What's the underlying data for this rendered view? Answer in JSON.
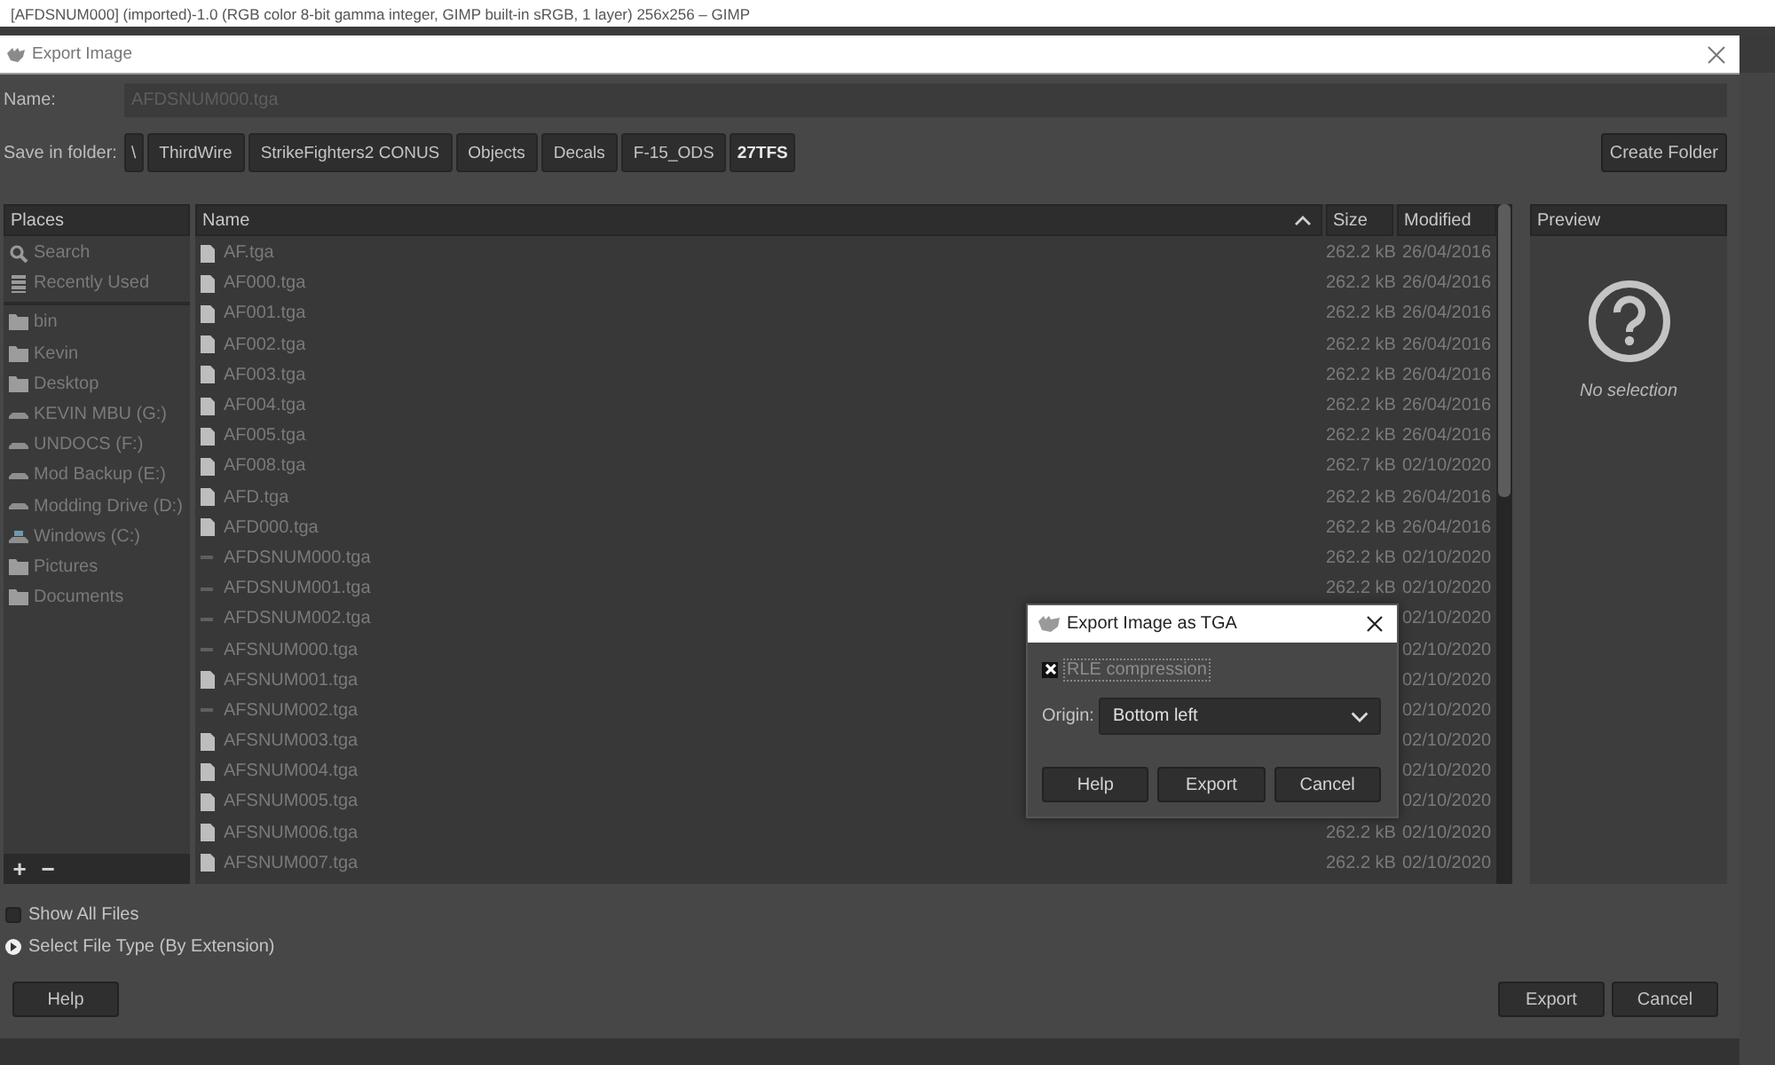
{
  "app_window": {
    "title": "[AFDSNUM000] (imported)-1.0 (RGB color 8-bit gamma integer, GIMP built-in sRGB, 1 layer) 256x256 – GIMP"
  },
  "export_dialog": {
    "title": "Export Image",
    "name_label": "Name:",
    "name_value": "AFDSNUM000.tga",
    "folder_label": "Save in folder:",
    "path": [
      {
        "label": "\\",
        "selected": false
      },
      {
        "label": "ThirdWire",
        "selected": false
      },
      {
        "label": "StrikeFighters2 CONUS",
        "selected": false
      },
      {
        "label": "Objects",
        "selected": false
      },
      {
        "label": "Decals",
        "selected": false
      },
      {
        "label": "F-15_ODS",
        "selected": false
      },
      {
        "label": "27TFS",
        "selected": true
      }
    ],
    "create_folder": "Create Folder",
    "places": {
      "header": "Places",
      "shortcuts": [
        {
          "label": "Search",
          "kind": "search"
        },
        {
          "label": "Recently Used",
          "kind": "recent"
        }
      ],
      "locations": [
        {
          "label": "bin",
          "kind": "folder"
        },
        {
          "label": "Kevin",
          "kind": "folder"
        },
        {
          "label": "Desktop",
          "kind": "folder"
        },
        {
          "label": "KEVIN MBU (G:)",
          "kind": "drive"
        },
        {
          "label": "UNDOCS (F:)",
          "kind": "drive"
        },
        {
          "label": "Mod Backup (E:)",
          "kind": "drive"
        },
        {
          "label": "Modding Drive (D:)",
          "kind": "drive"
        },
        {
          "label": "Windows (C:)",
          "kind": "system-drive"
        },
        {
          "label": "Pictures",
          "kind": "folder"
        },
        {
          "label": "Documents",
          "kind": "folder"
        }
      ],
      "buttons": [
        "+",
        "−"
      ]
    },
    "columns": [
      {
        "label": "Name",
        "sorted": true
      },
      {
        "label": "Size",
        "sorted": false
      },
      {
        "label": "Modified",
        "sorted": false
      }
    ],
    "files": [
      {
        "name": "AF.tga",
        "kind": "document",
        "size": "262.2 kB",
        "modified": "26/04/2016"
      },
      {
        "name": "AF000.tga",
        "kind": "document",
        "size": "262.2 kB",
        "modified": "26/04/2016"
      },
      {
        "name": "AF001.tga",
        "kind": "document",
        "size": "262.2 kB",
        "modified": "26/04/2016"
      },
      {
        "name": "AF002.tga",
        "kind": "document",
        "size": "262.2 kB",
        "modified": "26/04/2016"
      },
      {
        "name": "AF003.tga",
        "kind": "document",
        "size": "262.2 kB",
        "modified": "26/04/2016"
      },
      {
        "name": "AF004.tga",
        "kind": "document",
        "size": "262.2 kB",
        "modified": "26/04/2016"
      },
      {
        "name": "AF005.tga",
        "kind": "document",
        "size": "262.2 kB",
        "modified": "26/04/2016"
      },
      {
        "name": "AF008.tga",
        "kind": "document",
        "size": "262.7 kB",
        "modified": "02/10/2020"
      },
      {
        "name": "AFD.tga",
        "kind": "document",
        "size": "262.2 kB",
        "modified": "26/04/2016"
      },
      {
        "name": "AFD000.tga",
        "kind": "document",
        "size": "262.2 kB",
        "modified": "26/04/2016"
      },
      {
        "name": "AFDSNUM000.tga",
        "kind": "thumbnail",
        "size": "262.2 kB",
        "modified": "02/10/2020"
      },
      {
        "name": "AFDSNUM001.tga",
        "kind": "thumbnail",
        "size": "262.2 kB",
        "modified": "02/10/2020"
      },
      {
        "name": "AFDSNUM002.tga",
        "kind": "thumbnail",
        "modified": "02/10/2020"
      },
      {
        "name": "AFSNUM000.tga",
        "kind": "thumbnail",
        "modified": "02/10/2020"
      },
      {
        "name": "AFSNUM001.tga",
        "kind": "document",
        "modified": "02/10/2020"
      },
      {
        "name": "AFSNUM002.tga",
        "kind": "thumbnail",
        "modified": "02/10/2020"
      },
      {
        "name": "AFSNUM003.tga",
        "kind": "document",
        "modified": "02/10/2020"
      },
      {
        "name": "AFSNUM004.tga",
        "kind": "document",
        "modified": "02/10/2020"
      },
      {
        "name": "AFSNUM005.tga",
        "kind": "document",
        "modified": "02/10/2020"
      },
      {
        "name": "AFSNUM006.tga",
        "kind": "document",
        "size": "262.2 kB",
        "modified": "02/10/2020"
      },
      {
        "name": "AFSNUM007.tga",
        "kind": "document",
        "size": "262.2 kB",
        "modified": "02/10/2020"
      }
    ],
    "preview": {
      "header": "Preview",
      "message": "No selection"
    },
    "show_all_files": {
      "label": "Show All Files",
      "checked": false
    },
    "file_type": {
      "label": "Select File Type (By Extension)",
      "expanded": false
    },
    "help_button": "Help",
    "buttons": [
      "Export",
      "Cancel"
    ]
  },
  "tga_dialog": {
    "title": "Export Image as TGA",
    "rle_compression": {
      "label": "RLE compression",
      "checked": true
    },
    "origin": {
      "label": "Origin:",
      "value": "Bottom left"
    },
    "buttons": [
      "Help",
      "Export",
      "Cancel"
    ]
  }
}
